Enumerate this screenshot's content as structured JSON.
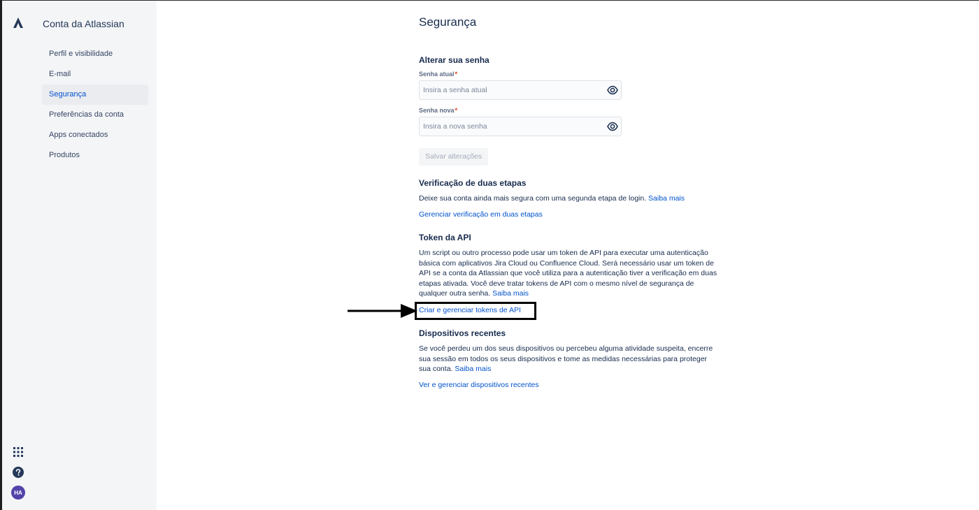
{
  "sidebar": {
    "title": "Conta da Atlassian",
    "items": [
      {
        "label": "Perfil e visibilidade"
      },
      {
        "label": "E-mail"
      },
      {
        "label": "Segurança"
      },
      {
        "label": "Preferências da conta"
      },
      {
        "label": "Apps conectados"
      },
      {
        "label": "Produtos"
      }
    ],
    "active_item": "Segurança"
  },
  "rail": {
    "avatar_initials": "HA",
    "icons": [
      "atlassian-logo-icon",
      "app-switcher-icon",
      "help-icon"
    ]
  },
  "main": {
    "page_title": "Segurança",
    "password": {
      "title": "Alterar sua senha",
      "current_label": "Senha atual",
      "current_placeholder": "Insira a senha atual",
      "new_label": "Senha nova",
      "new_placeholder": "Insira a nova senha",
      "required_mark": "*",
      "save_label": "Salvar alterações"
    },
    "two_step": {
      "title": "Verificação de duas etapas",
      "text": "Deixe sua conta ainda mais segura com uma segunda etapa de login.",
      "learn_more": "Saiba mais",
      "manage_link": "Gerenciar verificação em duas etapas"
    },
    "api_token": {
      "title": "Token da API",
      "text": "Um script ou outro processo pode usar um token de API para executar uma autenticação básica com aplicativos Jira Cloud ou Confluence Cloud. Será necessário usar um token de API se a conta da Atlassian que você utiliza para a autenticação tiver a verificação em duas etapas ativada. Você deve tratar tokens de API com o mesmo nível de segurança de qualquer outra senha.",
      "learn_more": "Saiba mais",
      "manage_link": "Criar e gerenciar tokens de API"
    },
    "devices": {
      "title": "Dispositivos recentes",
      "text": "Se você perdeu um dos seus dispositivos ou percebeu alguma atividade suspeita, encerre sua sessão em todos os seus dispositivos e tome as medidas necessárias para proteger sua conta.",
      "learn_more": "Saiba mais",
      "manage_link": "Ver e gerenciar dispositivos recentes"
    }
  },
  "colors": {
    "link": "#0052cc",
    "nav_bg": "#f4f5f7",
    "active_nav_bg": "#ebecf0",
    "avatar": "#5243aa",
    "required": "#de350b"
  }
}
